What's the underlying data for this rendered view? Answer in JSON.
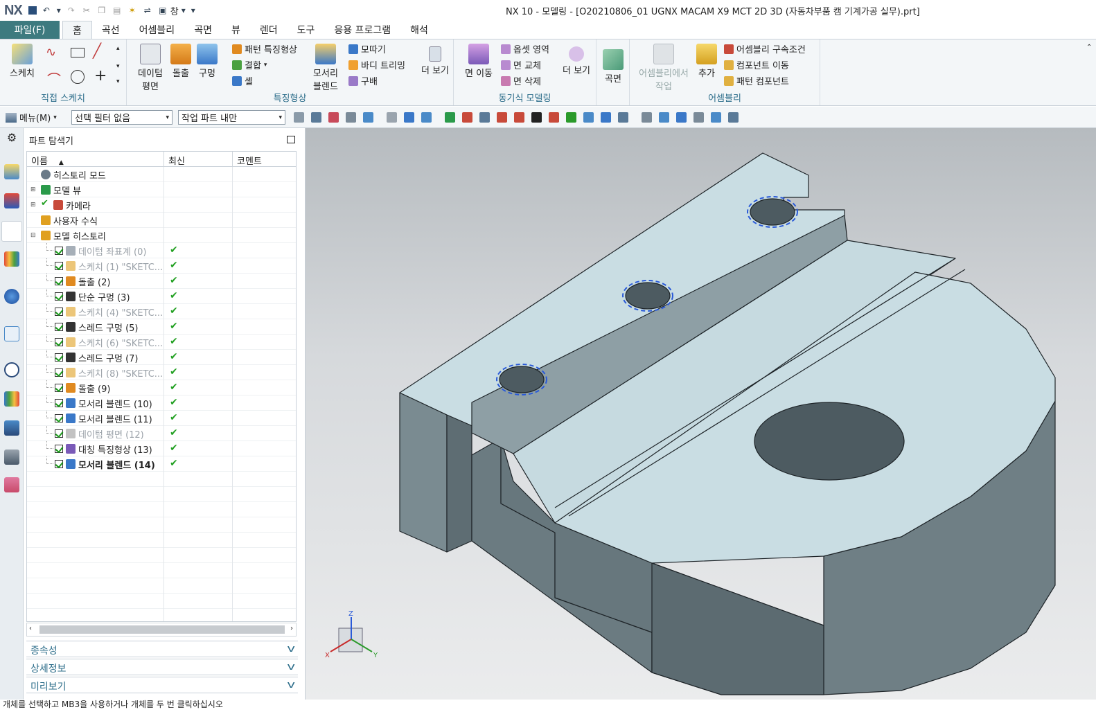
{
  "window": {
    "logo": "NX",
    "title": "NX 10 - 모델링 - [O20210806_01 UGNX MACAM X9 MCT 2D 3D (자동차부품 캠 기계가공 실무).prt]",
    "window_menu": "창"
  },
  "tabs": {
    "file": "파일(F)",
    "items": [
      "홈",
      "곡선",
      "어셈블리",
      "곡면",
      "뷰",
      "렌더",
      "도구",
      "응용 프로그램",
      "해석"
    ],
    "active": "홈"
  },
  "ribbon": {
    "sketch": {
      "label": "스케치",
      "group": "직접 스케치"
    },
    "datum": {
      "label1": "데이텀",
      "label2": "평면"
    },
    "extrude": "돌출",
    "hole": "구멍",
    "feature_small": [
      "패턴 특징형상",
      "결합",
      "셸"
    ],
    "edge_blend": {
      "label1": "모서리",
      "label2": "블렌드"
    },
    "feature_small2": [
      "모따기",
      "바디 트리밍",
      "구배"
    ],
    "more1": "더 보기",
    "feature_group": "특징형상",
    "move_face": "면 이동",
    "sync_small": [
      "옵셋 영역",
      "면 교체",
      "면 삭제"
    ],
    "more2": "더 보기",
    "sync_group": "동기식 모델링",
    "surface": "곡면",
    "asm_work": {
      "label1": "어셈블리에서",
      "label2": "작업"
    },
    "add": "추가",
    "asm_small": [
      "어셈블리 구속조건",
      "컴포넌트 이동",
      "패턴 컴포넌트"
    ],
    "asm_group": "어셈블리"
  },
  "cmdbar": {
    "menu": "메뉴(M)",
    "filter": "선택 필터 없음",
    "scope": "작업 파트 내만"
  },
  "navigator": {
    "title": "파트 탐색기",
    "columns": [
      "이름",
      "최신",
      "코멘트"
    ],
    "top_nodes": [
      "히스토리 모드",
      "모델 뷰",
      "카메라",
      "사용자 수식",
      "모델 히스토리"
    ],
    "features": [
      {
        "label": "데이텀 좌표계 (0)",
        "dim": true,
        "bold": false,
        "icon": "datum-csys-icon",
        "color": "#6a7a88"
      },
      {
        "label": "스케치 (1) \"SKETC...",
        "dim": true,
        "bold": false,
        "icon": "sketch-icon",
        "color": "#e0a020"
      },
      {
        "label": "돌출 (2)",
        "dim": false,
        "bold": false,
        "icon": "extrude-icon",
        "color": "#e08a20"
      },
      {
        "label": "단순 구멍 (3)",
        "dim": false,
        "bold": false,
        "icon": "simple-hole-icon",
        "color": "#333333"
      },
      {
        "label": "스케치 (4) \"SKETC...",
        "dim": true,
        "bold": false,
        "icon": "sketch-icon",
        "color": "#e0a020"
      },
      {
        "label": "스레드 구멍 (5)",
        "dim": false,
        "bold": false,
        "icon": "threaded-hole-icon",
        "color": "#333333"
      },
      {
        "label": "스케치 (6) \"SKETC...",
        "dim": true,
        "bold": false,
        "icon": "sketch-icon",
        "color": "#e0a020"
      },
      {
        "label": "스레드 구멍 (7)",
        "dim": false,
        "bold": false,
        "icon": "threaded-hole-icon",
        "color": "#333333"
      },
      {
        "label": "스케치 (8) \"SKETC...",
        "dim": true,
        "bold": false,
        "icon": "sketch-icon",
        "color": "#e0a020"
      },
      {
        "label": "돌출 (9)",
        "dim": false,
        "bold": false,
        "icon": "extrude-icon",
        "color": "#e08a20"
      },
      {
        "label": "모서리 블렌드 (10)",
        "dim": false,
        "bold": false,
        "icon": "edge-blend-icon",
        "color": "#3a78c8"
      },
      {
        "label": "모서리 블렌드 (11)",
        "dim": false,
        "bold": false,
        "icon": "edge-blend-icon",
        "color": "#3a78c8"
      },
      {
        "label": "데이텀 평면 (12)",
        "dim": true,
        "bold": false,
        "icon": "datum-plane-icon",
        "color": "#999999"
      },
      {
        "label": "대칭 특징형상 (13)",
        "dim": false,
        "bold": false,
        "icon": "mirror-feature-icon",
        "color": "#7a5ab8"
      },
      {
        "label": "모서리 블렌드 (14)",
        "dim": false,
        "bold": true,
        "icon": "edge-blend-icon",
        "color": "#3a78c8"
      }
    ],
    "sections": [
      "종속성",
      "상세정보",
      "미리보기"
    ]
  },
  "viewport": {
    "triad": {
      "x": "X",
      "y": "Y",
      "z": "Z"
    }
  },
  "status": "개체를 선택하고 MB3을 사용하거나 개체를 두 번 클릭하십시오",
  "colors": {
    "accent": "#3d7a7f",
    "link": "#2c6d8a",
    "model_top": "#c9dde3",
    "model_side": "#7d8e94",
    "check": "#22a022"
  }
}
